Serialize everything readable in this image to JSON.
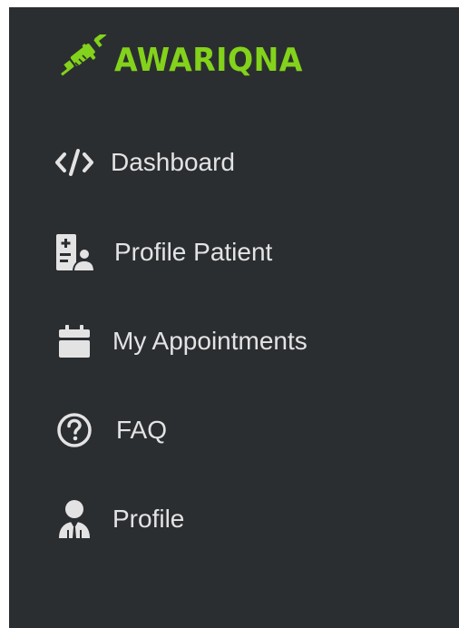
{
  "brand": {
    "name": "AWARIQNA",
    "logo_icon": "syringe-icon",
    "accent_color": "#83d21b"
  },
  "sidebar": {
    "background": "#2b2e31",
    "text_color": "#e3e3e3",
    "items": [
      {
        "label": "Dashboard",
        "icon": "code-icon"
      },
      {
        "label": "Profile Patient",
        "icon": "patient-file-icon"
      },
      {
        "label": "My Appointments",
        "icon": "calendar-icon"
      },
      {
        "label": "FAQ",
        "icon": "question-circle-icon"
      },
      {
        "label": "Profile",
        "icon": "user-tie-icon"
      }
    ]
  }
}
